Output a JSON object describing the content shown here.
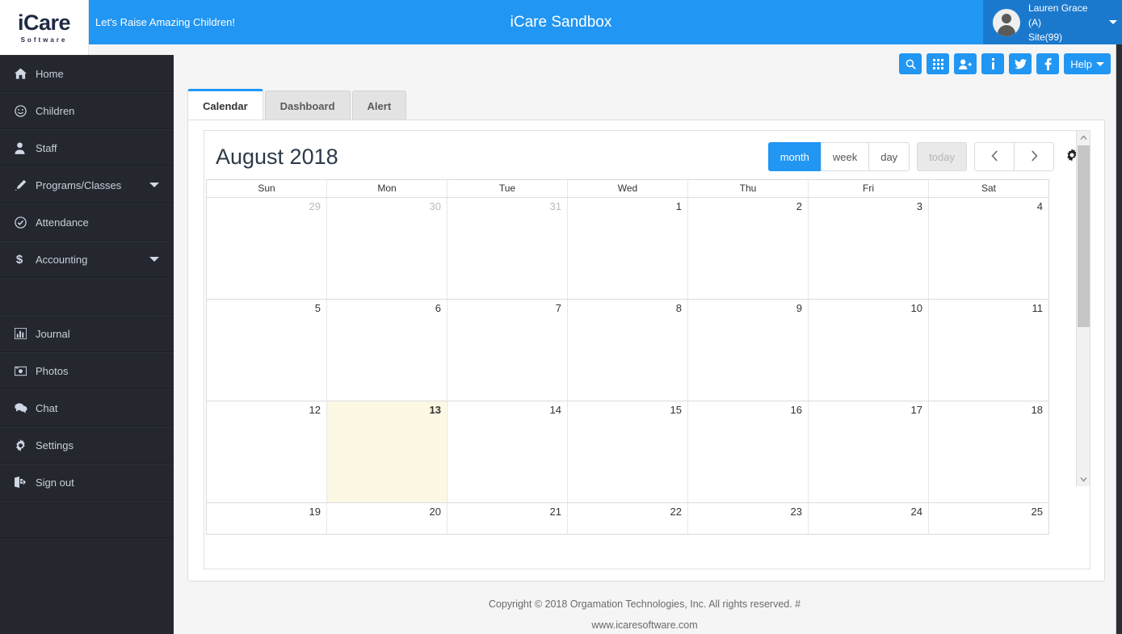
{
  "header": {
    "logo_main": "iCare",
    "logo_sub": "Software",
    "tagline": "Let's Raise Amazing Children!",
    "app_title": "iCare Sandbox",
    "user_name": "Lauren Grace (A)",
    "user_site": "Site(99)",
    "avatar_icon": "avatar-icon",
    "caret_icon": "caret-down-icon",
    "brand_blue": "#2196f3",
    "user_box_blue": "#1b79cd"
  },
  "toolbar": {
    "buttons": [
      {
        "icon": "search-icon",
        "label": ""
      },
      {
        "icon": "grid-icon",
        "label": ""
      },
      {
        "icon": "user-plus-icon",
        "label": ""
      },
      {
        "icon": "info-icon",
        "label": ""
      },
      {
        "icon": "twitter-icon",
        "label": ""
      },
      {
        "icon": "facebook-icon",
        "label": ""
      }
    ],
    "help_label": "Help",
    "help_caret_icon": "caret-down-icon"
  },
  "sidebar": {
    "items": [
      {
        "label": "Home",
        "icon": "home-icon",
        "caret": false
      },
      {
        "label": "Children",
        "icon": "smiley-icon",
        "caret": false
      },
      {
        "label": "Staff",
        "icon": "user-icon",
        "caret": false
      },
      {
        "label": "Programs/Classes",
        "icon": "pencil-icon",
        "caret": true
      },
      {
        "label": "Attendance",
        "icon": "check-circle-icon",
        "caret": false
      },
      {
        "label": "Accounting",
        "icon": "dollar-icon",
        "caret": true
      }
    ],
    "items2": [
      {
        "label": "Journal",
        "icon": "bar-chart-icon",
        "caret": false
      },
      {
        "label": "Photos",
        "icon": "camera-icon",
        "caret": false
      },
      {
        "label": "Chat",
        "icon": "chat-icon",
        "caret": false
      },
      {
        "label": "Settings",
        "icon": "gear-icon",
        "caret": false
      },
      {
        "label": "Sign out",
        "icon": "sign-out-icon",
        "caret": false
      }
    ]
  },
  "tabs": [
    {
      "label": "Calendar",
      "active": true
    },
    {
      "label": "Dashboard",
      "active": false
    },
    {
      "label": "Alert",
      "active": false
    }
  ],
  "calendar": {
    "title": "August 2018",
    "views": [
      {
        "label": "month",
        "state": "active"
      },
      {
        "label": "week",
        "state": "normal"
      },
      {
        "label": "day",
        "state": "normal"
      }
    ],
    "today_label": "today",
    "today_state": "disabled",
    "prev_icon": "chevron-left-icon",
    "next_icon": "chevron-right-icon",
    "settings_icon": "gear-icon",
    "day_headers": [
      "Sun",
      "Mon",
      "Tue",
      "Wed",
      "Thu",
      "Fri",
      "Sat"
    ],
    "today_date": "13",
    "weeks": [
      [
        {
          "n": "29",
          "other": true
        },
        {
          "n": "30",
          "other": true
        },
        {
          "n": "31",
          "other": true
        },
        {
          "n": "1",
          "other": false
        },
        {
          "n": "2",
          "other": false
        },
        {
          "n": "3",
          "other": false
        },
        {
          "n": "4",
          "other": false
        }
      ],
      [
        {
          "n": "5",
          "other": false
        },
        {
          "n": "6",
          "other": false
        },
        {
          "n": "7",
          "other": false
        },
        {
          "n": "8",
          "other": false
        },
        {
          "n": "9",
          "other": false
        },
        {
          "n": "10",
          "other": false
        },
        {
          "n": "11",
          "other": false
        }
      ],
      [
        {
          "n": "12",
          "other": false
        },
        {
          "n": "13",
          "other": false,
          "today": true
        },
        {
          "n": "14",
          "other": false
        },
        {
          "n": "15",
          "other": false
        },
        {
          "n": "16",
          "other": false
        },
        {
          "n": "17",
          "other": false
        },
        {
          "n": "18",
          "other": false
        }
      ],
      [
        {
          "n": "19",
          "other": false
        },
        {
          "n": "20",
          "other": false
        },
        {
          "n": "21",
          "other": false
        },
        {
          "n": "22",
          "other": false
        },
        {
          "n": "23",
          "other": false
        },
        {
          "n": "24",
          "other": false
        },
        {
          "n": "25",
          "other": false
        }
      ]
    ],
    "today_highlight_color": "#fcf8e3"
  },
  "footer": {
    "copyright": "Copyright © 2018 Orgamation Technologies, Inc. All rights reserved. #",
    "website": "www.icaresoftware.com"
  }
}
